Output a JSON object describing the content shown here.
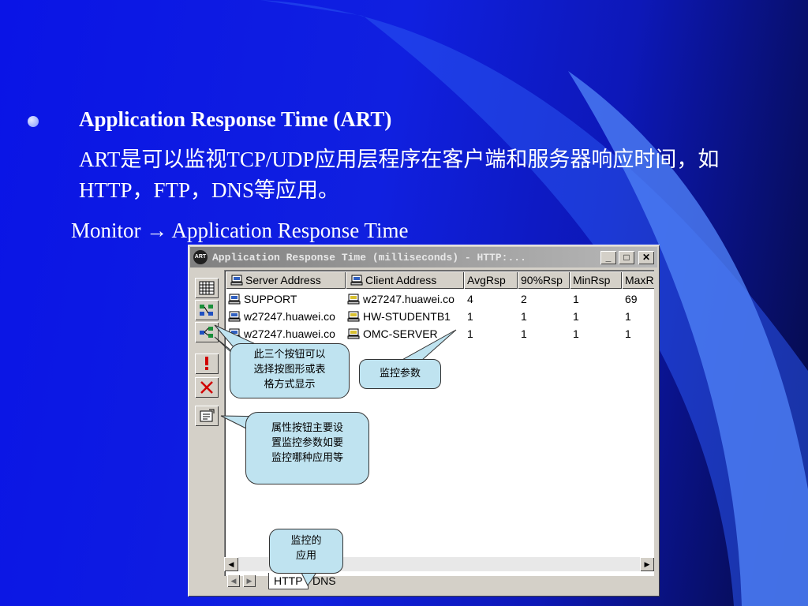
{
  "slide": {
    "title": "Application Response Time (ART)",
    "description": "ART是可以监视TCP/UDP应用层程序在客户端和服务器响应时间，如HTTP，FTP，DNS等应用。",
    "menu_path": "Monitor → Application Response Time"
  },
  "window": {
    "title": "Application Response Time (milliseconds) - HTTP:...",
    "app_icon_text": "ART",
    "min_label": "_",
    "max_label": "□",
    "close_label": "✕",
    "columns": [
      "Server Address",
      "Client Address",
      "AvgRsp",
      "90%Rsp",
      "MinRsp",
      "MaxR"
    ],
    "rows": [
      {
        "server": "SUPPORT",
        "client": "w27247.huawei.co",
        "avg": "4",
        "p90": "2",
        "min": "1",
        "max": "69"
      },
      {
        "server": "w27247.huawei.co",
        "client": "HW-STUDENTB1",
        "avg": "1",
        "p90": "1",
        "min": "1",
        "max": "1"
      },
      {
        "server": "w27247.huawei.co",
        "client": "OMC-SERVER",
        "avg": "1",
        "p90": "1",
        "min": "1",
        "max": "1"
      }
    ],
    "tabs": [
      "HTTP",
      "DNS"
    ],
    "scroll_left": "◀",
    "scroll_right": "▶",
    "tab_prev": "◀",
    "tab_next": "▶"
  },
  "callouts": {
    "view_buttons": [
      "此三个按钮可以",
      "选择按图形或表",
      "格方式显示"
    ],
    "monitor_params": "监控参数",
    "properties": [
      "属性按钮主要设",
      "置监控参数如要",
      "监控哪种应用等"
    ],
    "monitored_app": [
      "监控的",
      "应用"
    ]
  },
  "colors": {
    "background": "#1020e0",
    "callout_fill": "#bfe3f0",
    "window_face": "#d4d0c8"
  },
  "icons": [
    "bullet-icon",
    "app-icon",
    "grid-view-icon",
    "graph-view-icon",
    "graph-view-2-icon",
    "alert-icon",
    "delete-icon",
    "properties-icon",
    "computer-icon"
  ]
}
